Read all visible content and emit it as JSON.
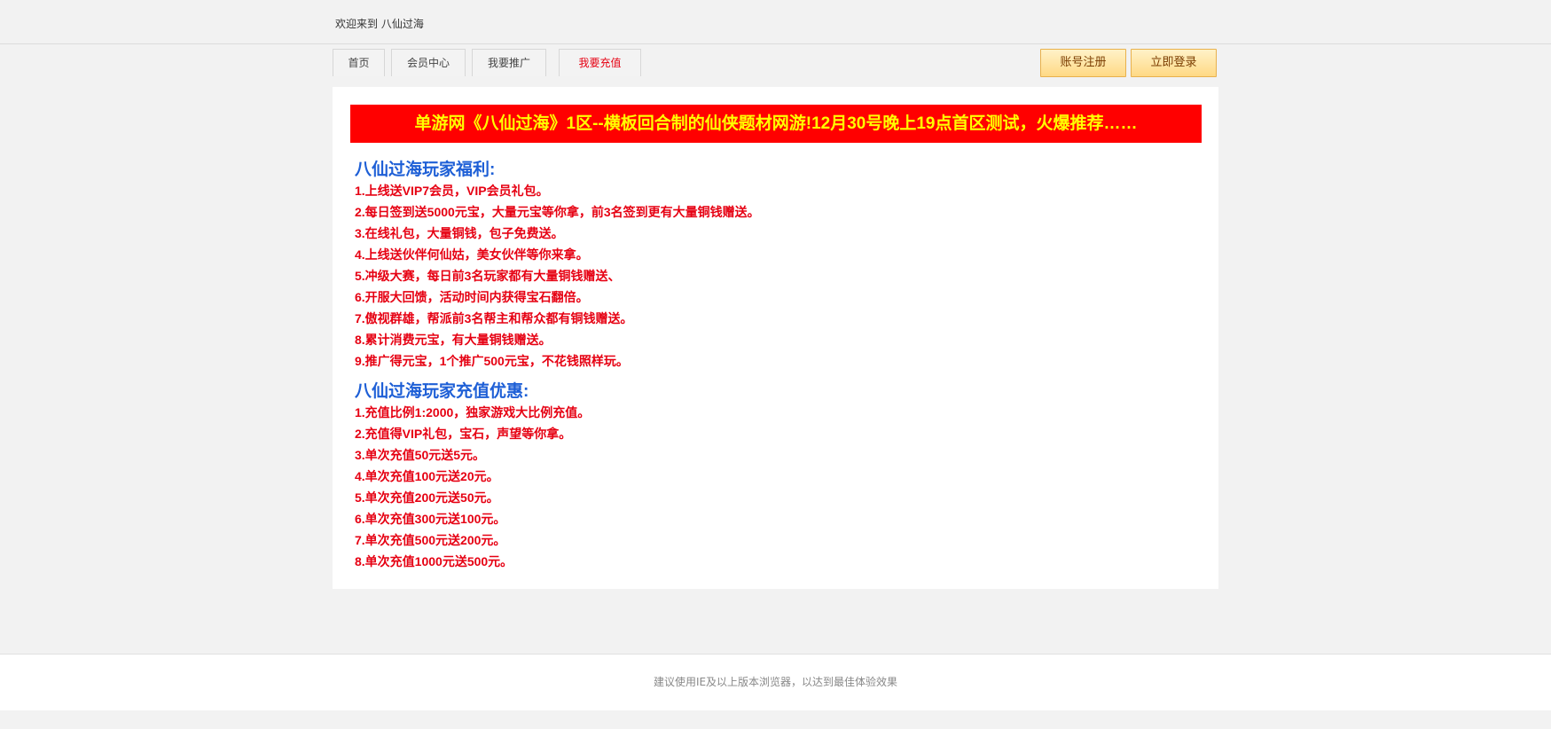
{
  "header": {
    "welcome": "欢迎来到 八仙过海"
  },
  "nav": {
    "tabs": [
      {
        "label": "首页"
      },
      {
        "label": "会员中心"
      },
      {
        "label": "我要推广"
      },
      {
        "label": "我要充值"
      }
    ],
    "active_tab_color": "#e60012",
    "register_label": "账号注册",
    "login_label": "立即登录"
  },
  "content": {
    "banner": "单游网《八仙过海》1区--横板回合制的仙侠题材网游!12月30号晚上19点首区测试，火爆推荐……",
    "welfare": {
      "title": "八仙过海玩家福利:",
      "items": [
        "1.上线送VIP7会员，VIP会员礼包。",
        "2.每日签到送5000元宝，大量元宝等你拿，前3名签到更有大量铜钱赠送。",
        "3.在线礼包，大量铜钱，包子免费送。",
        "4.上线送伙伴何仙姑，美女伙伴等你来拿。",
        "5.冲级大赛，每日前3名玩家都有大量铜钱赠送、",
        "6.开服大回馈，活动时间内获得宝石翻倍。",
        "7.傲视群雄，帮派前3名帮主和帮众都有铜钱赠送。",
        "8.累计消费元宝，有大量铜钱赠送。",
        "9.推广得元宝，1个推广500元宝，不花钱照样玩。"
      ]
    },
    "recharge": {
      "title": "八仙过海玩家充值优惠:",
      "items": [
        "1.充值比例1:2000，独家游戏大比例充值。",
        "2.充值得VIP礼包，宝石，声望等你拿。",
        "3.单次充值50元送5元。",
        "4.单次充值100元送20元。",
        "5.单次充值200元送50元。",
        "6.单次充值300元送100元。",
        "7.单次充值500元送200元。",
        "8.单次充值1000元送500元。"
      ]
    }
  },
  "footer": {
    "text": "建议使用IE及以上版本浏览器，以达到最佳体验效果"
  },
  "colors": {
    "banner_bg": "#ff0000",
    "banner_text": "#ffff00",
    "section_title": "#1e5fd6",
    "list_text": "#e60012",
    "button_bg": "#ffd985"
  }
}
